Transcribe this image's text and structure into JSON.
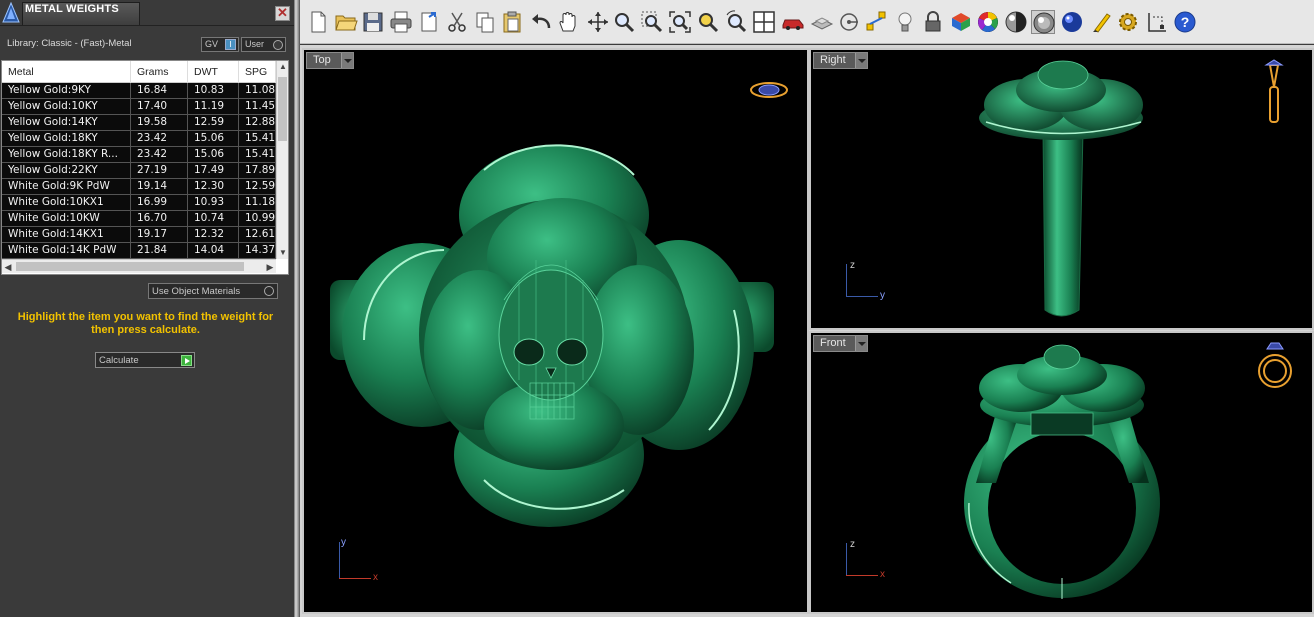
{
  "panel": {
    "title": "METAL WEIGHTS",
    "close_label": "✕",
    "library_label": "Library: Classic - (Fast)-Metal",
    "gv_label": "GV",
    "gv_knob": "I",
    "user_label": "User",
    "columns": [
      "Metal",
      "Grams",
      "DWT",
      "SPG"
    ],
    "rows": [
      [
        "Yellow Gold:9KY",
        "16.84",
        "10.83",
        "11.08"
      ],
      [
        "Yellow Gold:10KY",
        "17.40",
        "11.19",
        "11.45"
      ],
      [
        "Yellow Gold:14KY",
        "19.58",
        "12.59",
        "12.88"
      ],
      [
        "Yellow Gold:18KY",
        "23.42",
        "15.06",
        "15.41"
      ],
      [
        "Yellow Gold:18KY R...",
        "23.42",
        "15.06",
        "15.41"
      ],
      [
        "Yellow Gold:22KY",
        "27.19",
        "17.49",
        "17.89"
      ],
      [
        "White Gold:9K PdW",
        "19.14",
        "12.30",
        "12.59"
      ],
      [
        "White Gold:10KX1",
        "16.99",
        "10.93",
        "11.18"
      ],
      [
        "White Gold:10KW",
        "16.70",
        "10.74",
        "10.99"
      ],
      [
        "White Gold:14KX1",
        "19.17",
        "12.32",
        "12.61"
      ],
      [
        "White Gold:14K PdW",
        "21.84",
        "14.04",
        "14.37"
      ]
    ],
    "use_object_materials": "Use Object Materials",
    "hint": "Highlight the item you want to find the weight for then press calculate.",
    "calculate_label": "Calculate"
  },
  "viewports": {
    "top": {
      "label": "Top",
      "axis_h": "x",
      "axis_v": "y"
    },
    "right": {
      "label": "Right",
      "axis_h": "y",
      "axis_v": "z"
    },
    "front": {
      "label": "Front",
      "axis_h": "x",
      "axis_v": "z"
    }
  },
  "toolbar_icons": [
    "new-file",
    "open-folder",
    "save",
    "print",
    "import",
    "cut",
    "copy",
    "paste",
    "undo",
    "pan-hand",
    "rotate-view",
    "zoom",
    "zoom-window",
    "zoom-extents",
    "zoom-selected",
    "zoom-dynamic",
    "four-viewports",
    "car",
    "layers",
    "snap",
    "point-edit",
    "light-bulb",
    "lock",
    "materials",
    "color-wheel",
    "shade-sphere",
    "render-sphere",
    "blue-sphere",
    "highlighter",
    "settings-gear",
    "dimension",
    "help"
  ],
  "colors": {
    "model_green": "#1e8c5a",
    "hint_yellow": "#f2c200",
    "axis_x": "#c23a2a",
    "axis_y": "#3a5aa8"
  }
}
